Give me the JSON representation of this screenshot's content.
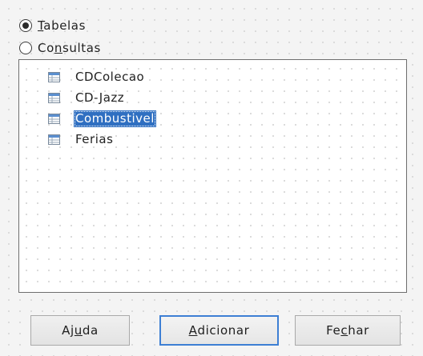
{
  "source_type": {
    "options": [
      {
        "label": "Tabelas",
        "mnemonic_index": 0,
        "selected": true
      },
      {
        "label": "Consultas",
        "mnemonic_index": 2,
        "selected": false
      }
    ]
  },
  "tables_list": {
    "items": [
      {
        "label": "CDColecao",
        "icon": "table-icon",
        "selected": false
      },
      {
        "label": "CD-Jazz",
        "icon": "table-icon",
        "selected": false
      },
      {
        "label": "Combustivel",
        "icon": "table-icon",
        "selected": true
      },
      {
        "label": "Ferias",
        "icon": "table-icon",
        "selected": false
      }
    ]
  },
  "buttons": {
    "help": {
      "label": "Ajuda",
      "mnemonic_index": 2
    },
    "add": {
      "label": "Adicionar",
      "mnemonic_index": 0,
      "default": true
    },
    "close": {
      "label": "Fechar",
      "mnemonic_index": 2
    }
  },
  "colors": {
    "selection": "#2f6fc1",
    "default_button_border": "#3d7fd4",
    "table_icon_header": "#5b8fcf"
  }
}
